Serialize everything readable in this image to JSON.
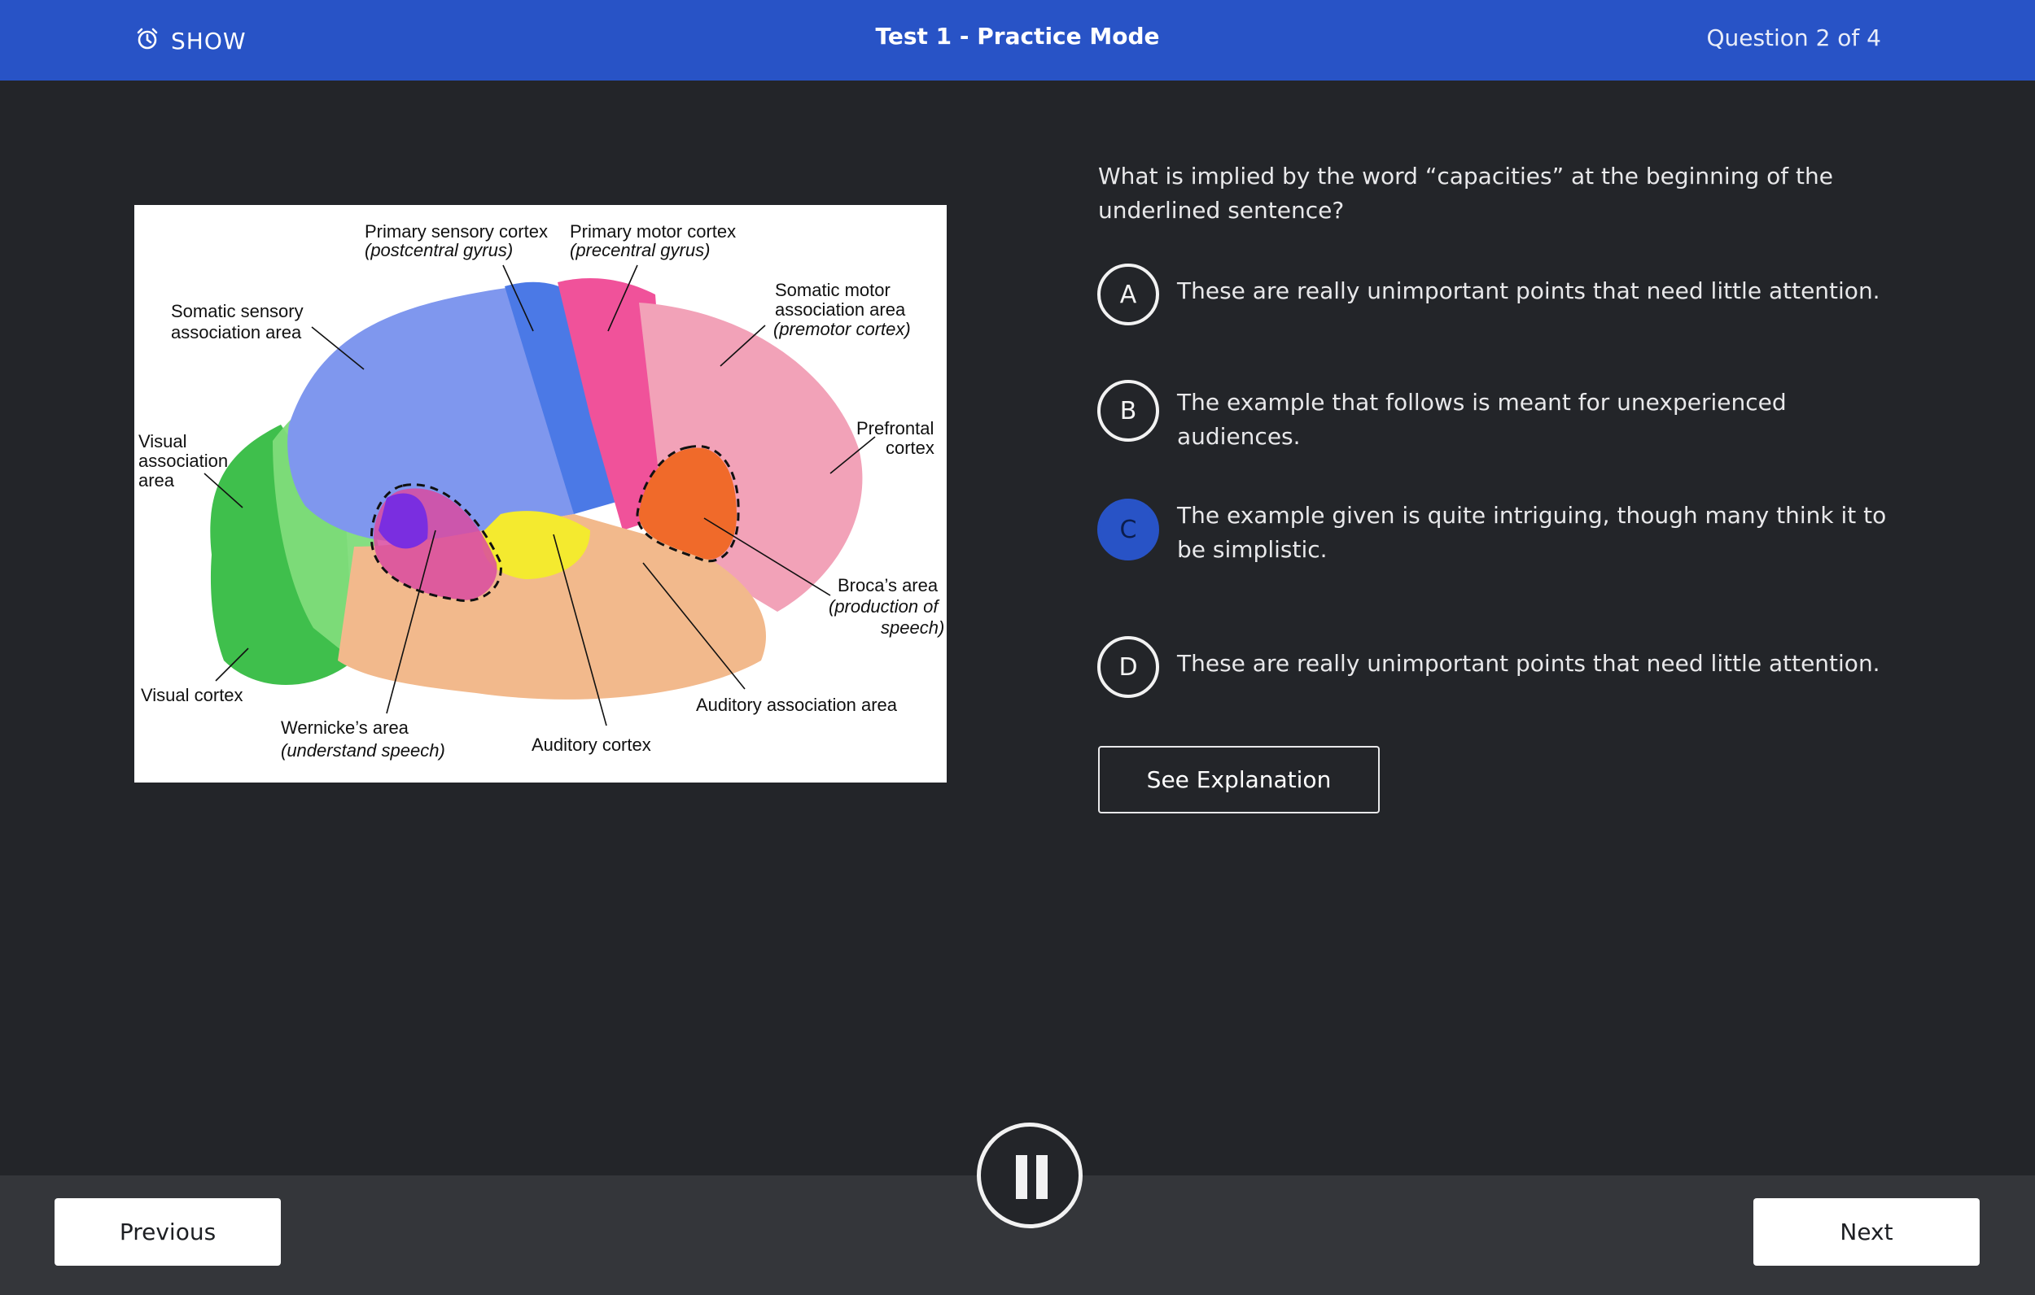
{
  "header": {
    "timer_label": "SHOW",
    "timer_icon": "alarm-clock-icon",
    "title": "Test 1 - Practice Mode",
    "progress": "Question 2 of 4"
  },
  "figure": {
    "labels": {
      "primary_sensory": "Primary sensory cortex",
      "primary_sensory_sub": "(postcentral gyrus)",
      "primary_motor": "Primary motor cortex",
      "primary_motor_sub": "(precentral gyrus)",
      "somatic_sensory_1": "Somatic sensory",
      "somatic_sensory_2": "association area",
      "somatic_motor_1": "Somatic motor",
      "somatic_motor_2": "association area",
      "somatic_motor_sub": "(premotor cortex)",
      "visual_assoc_1": "Visual",
      "visual_assoc_2": "association",
      "visual_assoc_3": "area",
      "prefrontal_1": "Prefrontal",
      "prefrontal_2": "cortex",
      "broca_1": "Broca’s area",
      "broca_sub_1": "(production of",
      "broca_sub_2": "speech)",
      "visual_cortex": "Visual cortex",
      "wernicke": "Wernicke’s area",
      "wernicke_sub": "(understand speech)",
      "auditory_cortex": "Auditory cortex",
      "auditory_assoc": "Auditory association area"
    }
  },
  "question": {
    "text": "What is implied by the word “capacities” at the beginning of the underlined sentence?",
    "selected": "C",
    "options": [
      {
        "letter": "A",
        "text": "These are really unimportant points that need little attention."
      },
      {
        "letter": "B",
        "text": "The example that follows is meant for unexperienced audiences."
      },
      {
        "letter": "C",
        "text": "The example given is quite intriguing, though many think it to be simplistic."
      },
      {
        "letter": "D",
        "text": "These are really unimportant points that need little attention."
      }
    ],
    "explanation_label": "See Explanation"
  },
  "footer": {
    "previous_label": "Previous",
    "next_label": "Next",
    "pause_icon": "pause-icon"
  },
  "colors": {
    "accent": "#2853c6",
    "background": "#232529",
    "footer": "#34363a"
  }
}
